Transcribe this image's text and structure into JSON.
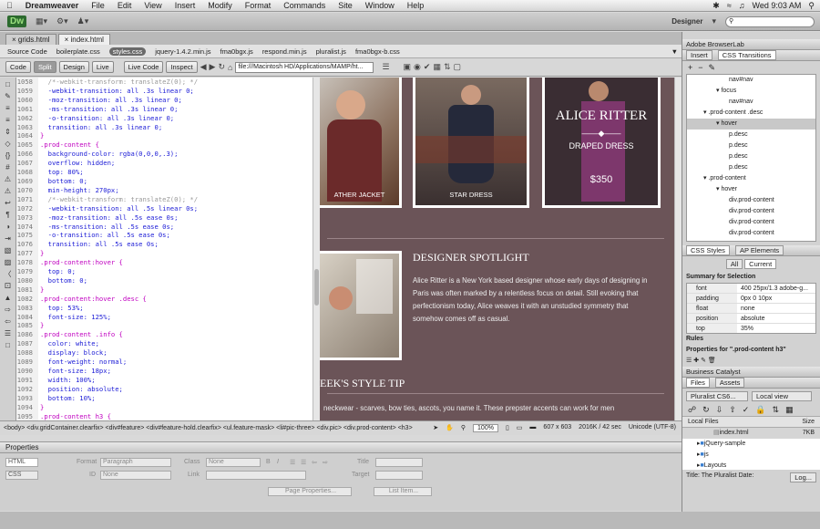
{
  "menubar": {
    "app": "Dreamweaver",
    "items": [
      "File",
      "Edit",
      "View",
      "Insert",
      "Modify",
      "Format",
      "Commands",
      "Site",
      "Window",
      "Help"
    ],
    "clock": "Wed 9:03 AM"
  },
  "appbar": {
    "logo": "Dw",
    "workspace": "Designer"
  },
  "doctabs": [
    "grids.html",
    "index.html"
  ],
  "related_files": [
    "Source Code",
    "boilerplate.css",
    "styles.css",
    "jquery-1.4.2.min.js",
    "fma0bgx.js",
    "respond.min.js",
    "pluralist.js",
    "fma0bgx-b.css"
  ],
  "toolbar": {
    "views": [
      "Code",
      "Split",
      "Design",
      "Live"
    ],
    "live_code": "Live Code",
    "inspect": "Inspect",
    "address": "file:///Macintosh HD/Applications/MAMP/ht..."
  },
  "code_lines": [
    {
      "n": "1058",
      "t": "  /*-webkit-transform: translateZ(0); */",
      "c": "c-cmt"
    },
    {
      "n": "1059",
      "t": "  -webkit-transition: all .3s linear 0;",
      "c": "c-prop"
    },
    {
      "n": "1060",
      "t": "  -moz-transition: all .3s linear 0;",
      "c": "c-prop"
    },
    {
      "n": "1061",
      "t": "  -ms-transition: all .3s linear 0;",
      "c": "c-prop"
    },
    {
      "n": "1062",
      "t": "  -o-transition: all .3s linear 0;",
      "c": "c-prop"
    },
    {
      "n": "1063",
      "t": "  transition: all .3s linear 0;",
      "c": "c-prop"
    },
    {
      "n": "1064",
      "t": "}",
      "c": "c-sel"
    },
    {
      "n": "1065",
      "t": ".prod-content {",
      "c": "c-sel"
    },
    {
      "n": "1066",
      "t": "  background-color: rgba(0,0,0,.3);",
      "c": "c-prop"
    },
    {
      "n": "1067",
      "t": "  overflow: hidden;",
      "c": "c-prop"
    },
    {
      "n": "1068",
      "t": "  top: 80%;",
      "c": "c-prop"
    },
    {
      "n": "1069",
      "t": "  bottom: 0;",
      "c": "c-prop"
    },
    {
      "n": "1070",
      "t": "  min-height: 270px;",
      "c": "c-prop"
    },
    {
      "n": "1071",
      "t": "  /*-webkit-transform: translateZ(0); */",
      "c": "c-cmt"
    },
    {
      "n": "1072",
      "t": "  -webkit-transition: all .5s linear 0s;",
      "c": "c-prop"
    },
    {
      "n": "1073",
      "t": "  -moz-transition: all .5s ease 0s;",
      "c": "c-prop"
    },
    {
      "n": "1074",
      "t": "  -ms-transition: all .5s ease 0s;",
      "c": "c-prop"
    },
    {
      "n": "1075",
      "t": "  -o-transition: all .5s ease 0s;",
      "c": "c-prop"
    },
    {
      "n": "1076",
      "t": "  transition: all .5s ease 0s;",
      "c": "c-prop"
    },
    {
      "n": "1077",
      "t": "}",
      "c": "c-sel"
    },
    {
      "n": "1078",
      "t": ".prod-content:hover {",
      "c": "c-sel"
    },
    {
      "n": "1079",
      "t": "  top: 0;",
      "c": "c-prop"
    },
    {
      "n": "1080",
      "t": "  bottom: 0;",
      "c": "c-prop"
    },
    {
      "n": "1081",
      "t": "}",
      "c": "c-sel"
    },
    {
      "n": "1082",
      "t": ".prod-content:hover .desc {",
      "c": "c-sel"
    },
    {
      "n": "1083",
      "t": "  top: 53%;",
      "c": "c-prop"
    },
    {
      "n": "1084",
      "t": "  font-size: 125%;",
      "c": "c-prop"
    },
    {
      "n": "1085",
      "t": "}",
      "c": "c-sel"
    },
    {
      "n": "1086",
      "t": ".prod-content .info {",
      "c": "c-sel"
    },
    {
      "n": "1087",
      "t": "  color: white;",
      "c": "c-prop"
    },
    {
      "n": "1088",
      "t": "  display: block;",
      "c": "c-prop"
    },
    {
      "n": "1089",
      "t": "  font-weight: normal;",
      "c": "c-prop"
    },
    {
      "n": "1090",
      "t": "  font-size: 18px;",
      "c": "c-prop"
    },
    {
      "n": "1091",
      "t": "  width: 100%;",
      "c": "c-prop"
    },
    {
      "n": "1092",
      "t": "  position: absolute;",
      "c": "c-prop"
    },
    {
      "n": "1093",
      "t": "  bottom: 10%;",
      "c": "c-prop"
    },
    {
      "n": "1094",
      "t": "}",
      "c": "c-sel"
    },
    {
      "n": "1095",
      "t": ".prod-content h3 {",
      "c": "c-sel"
    }
  ],
  "design": {
    "caption1": "ATHER JACKET",
    "caption2": "STAR DRESS",
    "brand": "ALICE RITTER",
    "draped": "DRAPED DRESS",
    "price": "$350",
    "spotlight_title": "DESIGNER SPOTLIGHT",
    "spotlight_text": "Alice Ritter is a New York based designer whose early days of designing in Paris was often marked by a relentless focus on detail. Still evoking that perfectionism today, Alice weaves it with an unstudied symmetry that somehow comes off as casual.",
    "tip_title": "EEK'S STYLE TIP",
    "tip_text": "neckwear - scarves, bow ties, ascots, you name it. These prepster accents can work for men"
  },
  "statusbar": {
    "path": "<body> <div.gridContainer.clearfix> <div#feature> <div#feature-hold.clearfix> <ul.feature-mask> <li#pic-three> <div.pic> <div.prod-content> <h3>",
    "zoom": "100%",
    "size": "607 x 603",
    "weight": "2016K / 42 sec",
    "encoding": "Unicode (UTF-8)"
  },
  "properties": {
    "title": "Properties",
    "html": "HTML",
    "css": "CSS",
    "format_label": "Format",
    "format_val": "Paragraph",
    "class_label": "Class",
    "class_val": "None",
    "id_label": "ID",
    "id_val": "None",
    "link_label": "Link",
    "title_label": "Title",
    "target_label": "Target",
    "page_props": "Page Properties...",
    "list_item": "List Item..."
  },
  "right": {
    "browserlab": "Adobe BrowserLab",
    "insert": "Insert",
    "css_transitions": "CSS Transitions",
    "tree": [
      {
        "t": "nav#nav",
        "d": 3
      },
      {
        "t": "focus",
        "d": 2,
        "a": "▾"
      },
      {
        "t": "nav#nav",
        "d": 3
      },
      {
        "t": ".prod-content .desc",
        "d": 1,
        "a": "▾"
      },
      {
        "t": "hover",
        "d": 2,
        "a": "▾",
        "sel": true
      },
      {
        "t": "p.desc",
        "d": 3
      },
      {
        "t": "p.desc",
        "d": 3
      },
      {
        "t": "p.desc",
        "d": 3
      },
      {
        "t": "p.desc",
        "d": 3
      },
      {
        "t": ".prod-content",
        "d": 1,
        "a": "▾"
      },
      {
        "t": "hover",
        "d": 2,
        "a": "▾"
      },
      {
        "t": "div.prod-content",
        "d": 3
      },
      {
        "t": "div.prod-content",
        "d": 3
      },
      {
        "t": "div.prod-content",
        "d": 3
      },
      {
        "t": "div.prod-content",
        "d": 3
      }
    ],
    "css_styles": "CSS Styles",
    "ap_elements": "AP Elements",
    "all": "All",
    "current": "Current",
    "summary": "Summary for Selection",
    "props": [
      {
        "k": "font",
        "v": "400 25px/1.3 adobe-g..."
      },
      {
        "k": "padding",
        "v": "0px 0 10px"
      },
      {
        "k": "float",
        "v": "none"
      },
      {
        "k": "position",
        "v": "absolute"
      },
      {
        "k": "top",
        "v": "35%"
      }
    ],
    "rules": "Rules",
    "props_for": "Properties for \".prod-content h3\"",
    "business": "Business Catalyst",
    "files": "Files",
    "assets": "Assets",
    "site": "Pluralist CS6...",
    "view": "Local view",
    "local_files": "Local Files",
    "size_col": "Size",
    "file_rows": [
      {
        "n": "index.html",
        "s": "7KB"
      },
      {
        "n": "jQuery-sample",
        "s": ""
      },
      {
        "n": "js",
        "s": ""
      },
      {
        "n": "Layouts",
        "s": ""
      }
    ],
    "footer": "Title: The Pluralist Date:",
    "log": "Log..."
  }
}
